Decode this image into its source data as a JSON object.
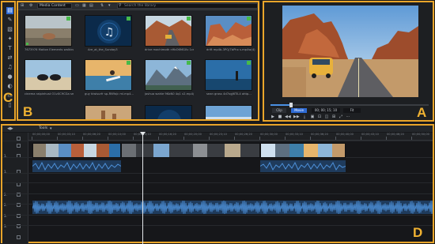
{
  "zones": {
    "a": "A",
    "b": "B",
    "c": "C",
    "d": "D"
  },
  "tool_strip": {
    "icons": [
      "media-room-icon",
      "effects-icon",
      "pip-icon",
      "particles-icon",
      "title-icon",
      "transition-icon",
      "audio-mix-icon",
      "voiceover-icon",
      "chapter-icon",
      "subtitle-icon",
      "more-icon"
    ],
    "glyphs": [
      "▤",
      "✎",
      "▧",
      "✦",
      "T",
      "⇄",
      "♫",
      "●",
      "◐",
      "▭",
      "▯"
    ]
  },
  "library": {
    "dropdown_value": "Media Content",
    "search_placeholder": "Search the library",
    "thumbnails": [
      {
        "caption": "7673976 Motion Elements walking..."
      },
      {
        "caption": "Are_at_the_Sunday3"
      },
      {
        "caption": "drive machimoth n9bO6MG0v 1cmp4..."
      },
      {
        "caption": "drift mp4b-3PQ/7bPhx s.mp4w(4).jpg"
      },
      {
        "caption": "cinema ralpinhust O1v0C9CGa smp..."
      },
      {
        "caption": "guy kiwisurfr sp-RNYa/c ml.mp4..."
      },
      {
        "caption": "joshua wahle 9KbN0 4q1 v2.mp4/..."
      },
      {
        "caption": "sean gross 4d7xgJ6TlL4 ahtp..."
      },
      {
        "caption": ""
      },
      {
        "caption": ""
      },
      {
        "caption": ""
      },
      {
        "caption": ""
      }
    ]
  },
  "preview": {
    "clip_label": "Clip",
    "movie_label": "Movie",
    "timecode": "00; 00; 15; 10",
    "quality": "Fit",
    "scrub_progress": 0.13,
    "controls": [
      "▶",
      "■",
      "◀◀",
      "▶▶",
      "⤓",
      "▣",
      "⊡",
      "◫",
      "⊞",
      "⤢",
      "⋯"
    ]
  },
  "timeline": {
    "tab_label": "Tools",
    "timecodes": [
      "00;00;00;00",
      "00;00;03;10",
      "00;00;06;20",
      "00;00;10;00",
      "00;00;13;10",
      "00;00;16;20",
      "00;00;20;00",
      "00;00;23;10",
      "00;00;26;20",
      "00;00;30;00",
      "00;00;33;10",
      "00;00;36;20",
      "00;00;40;00",
      "00;00;43;10",
      "00;00;46;20",
      "00;00;50;00"
    ],
    "track_numbers": [
      "1.",
      "1.",
      "",
      "2.",
      "2.",
      "3.",
      "3.",
      ""
    ]
  }
}
